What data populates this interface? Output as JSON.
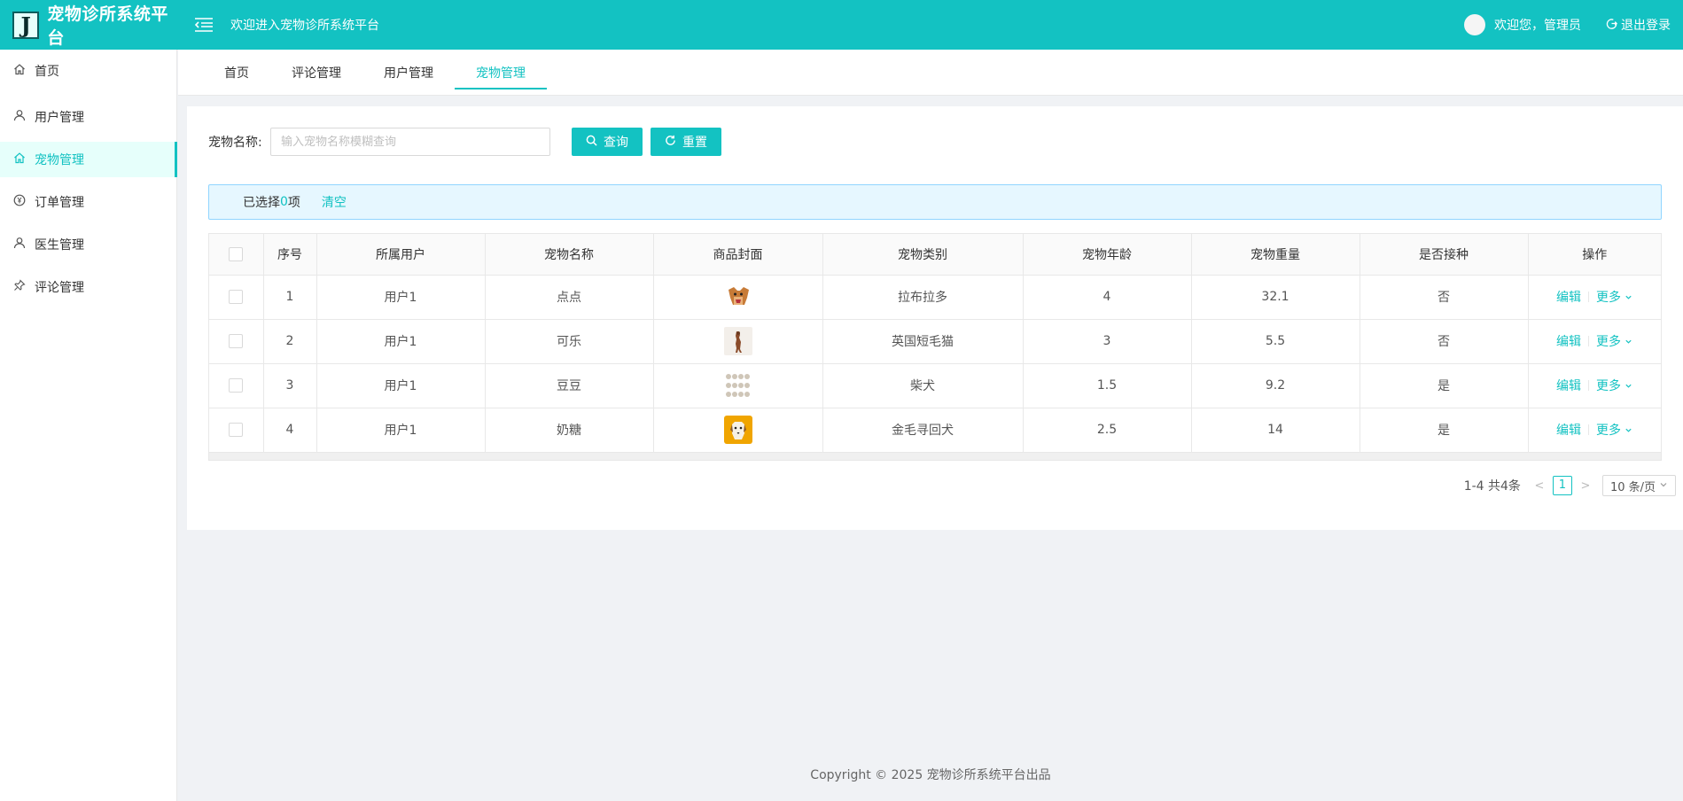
{
  "app": {
    "logo_letter": "J",
    "title": "宠物诊所系统平台",
    "welcome": "欢迎进入宠物诊所系统平台"
  },
  "user": {
    "greeting": "欢迎您，管理员",
    "logout": "退出登录"
  },
  "sidebar": {
    "items": [
      {
        "label": "首页",
        "icon": "home-icon"
      },
      {
        "label": "用户管理",
        "icon": "user-icon"
      },
      {
        "label": "宠物管理",
        "icon": "home-icon",
        "active": true
      },
      {
        "label": "订单管理",
        "icon": "yen-icon"
      },
      {
        "label": "医生管理",
        "icon": "user-icon"
      },
      {
        "label": "评论管理",
        "icon": "pushpin-icon"
      }
    ]
  },
  "tabs": [
    {
      "label": "首页"
    },
    {
      "label": "评论管理"
    },
    {
      "label": "用户管理"
    },
    {
      "label": "宠物管理",
      "active": true
    }
  ],
  "search": {
    "label": "宠物名称:",
    "placeholder": "输入宠物名称模糊查询",
    "value": "",
    "query_button": "查询",
    "reset_button": "重置"
  },
  "selection": {
    "prefix": "已选择 ",
    "count": "0",
    "suffix": "项",
    "clear": "清空"
  },
  "table": {
    "columns": [
      "序号",
      "所属用户",
      "宠物名称",
      "商品封面",
      "宠物类别",
      "宠物年龄",
      "宠物重量",
      "是否接种",
      "操作"
    ],
    "rows": [
      {
        "index": "1",
        "owner": "用户1",
        "name": "点点",
        "cover": "dog-photo",
        "category": "拉布拉多",
        "age": "4",
        "weight": "32.1",
        "vaccinated": "否",
        "edit": "编辑",
        "more": "更多"
      },
      {
        "index": "2",
        "owner": "用户1",
        "name": "可乐",
        "cover": "dancing-dog-photo",
        "category": "英国短毛猫",
        "age": "3",
        "weight": "5.5",
        "vaccinated": "否",
        "edit": "编辑",
        "more": "更多"
      },
      {
        "index": "3",
        "owner": "用户1",
        "name": "豆豆",
        "cover": "grid-photo",
        "category": "柴犬",
        "age": "1.5",
        "weight": "9.2",
        "vaccinated": "是",
        "edit": "编辑",
        "more": "更多"
      },
      {
        "index": "4",
        "owner": "用户1",
        "name": "奶糖",
        "cover": "golden-dog-photo",
        "category": "金毛寻回犬",
        "age": "2.5",
        "weight": "14",
        "vaccinated": "是",
        "edit": "编辑",
        "more": "更多"
      }
    ]
  },
  "pagination": {
    "total_text": "1-4 共4条",
    "current_page": "1",
    "page_size": "10 条/页"
  },
  "footer": {
    "text": "Copyright © 2025 宠物诊所系统平台出品"
  },
  "colors": {
    "primary": "#13c2c2",
    "alert_bg": "#e6f7ff",
    "alert_border": "#91d5ff"
  }
}
